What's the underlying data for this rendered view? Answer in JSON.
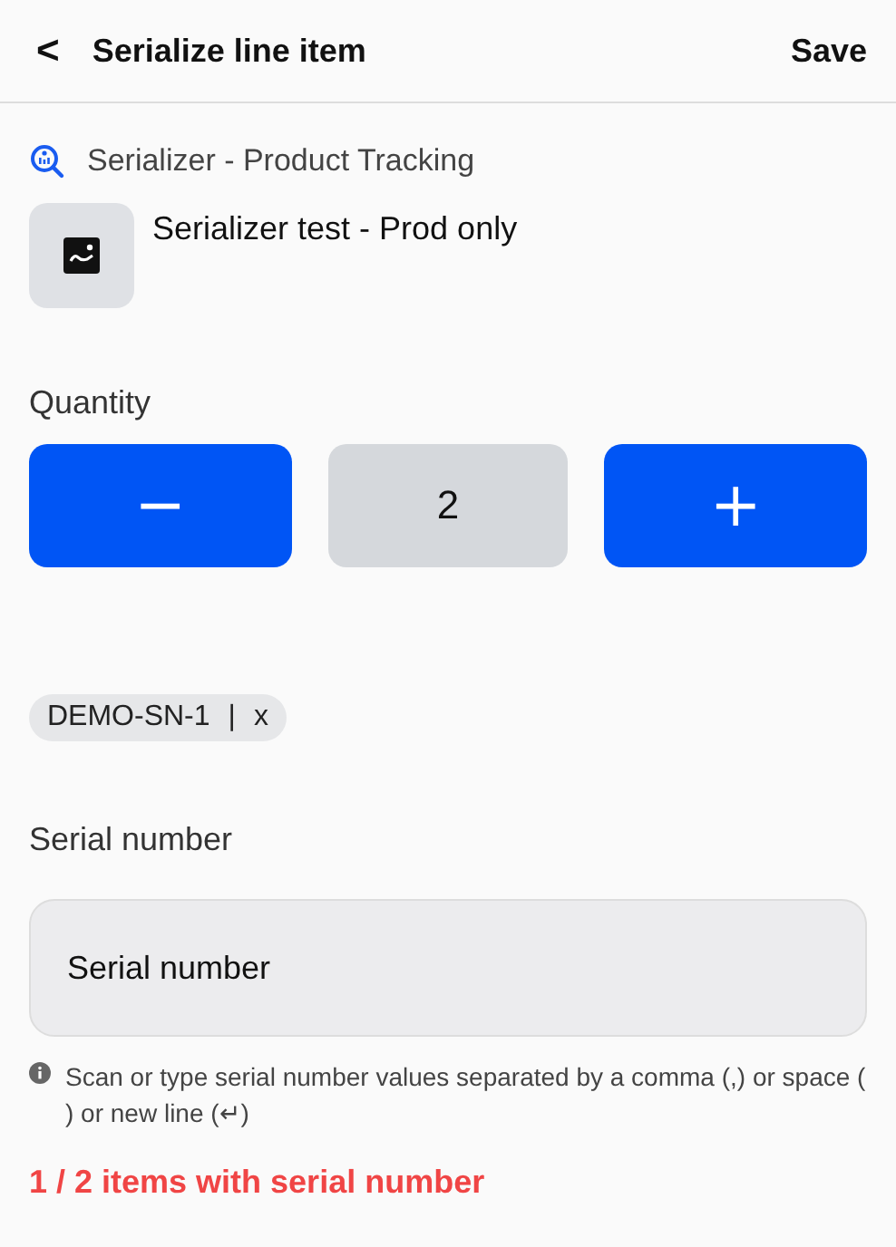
{
  "header": {
    "back": "<",
    "title": "Serialize line item",
    "action": "Save"
  },
  "app_name": "Serializer - Product Tracking",
  "product": {
    "name": "Serializer test - Prod only"
  },
  "quantity": {
    "label": "Quantity",
    "minus": "−",
    "value": "2",
    "plus": "+"
  },
  "chips": [
    {
      "value": "DEMO-SN-1",
      "separator": "|",
      "remove": "x"
    }
  ],
  "serial": {
    "label": "Serial number",
    "placeholder": "Serial number",
    "hint": "Scan or type serial number values separated by a comma (,) or space ( ) or new line (↵)"
  },
  "status": "1 / 2 items with serial number"
}
